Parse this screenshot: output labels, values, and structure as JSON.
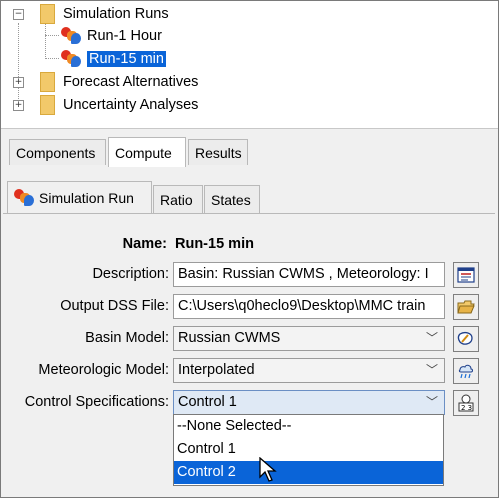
{
  "tree": {
    "items": [
      {
        "label": "Simulation Runs",
        "expander": "−"
      },
      {
        "label": "Run-1 Hour"
      },
      {
        "label": "Run-15 min",
        "selected": true
      },
      {
        "label": "Forecast Alternatives",
        "expander": "+"
      },
      {
        "label": "Uncertainty Analyses",
        "expander": "+"
      }
    ]
  },
  "outer_tabs": [
    {
      "label": "Components",
      "active": false
    },
    {
      "label": "Compute",
      "active": true
    },
    {
      "label": "Results",
      "active": false
    }
  ],
  "inner_tabs": [
    {
      "label": "Simulation Run",
      "active": true
    },
    {
      "label": "Ratio",
      "active": false
    },
    {
      "label": "States",
      "active": false
    }
  ],
  "form": {
    "name_label": "Name:",
    "name_value": "Run-15 min",
    "description_label": "Description:",
    "description_value": "Basin: Russian CWMS , Meteorology: I",
    "dss_label": "Output DSS File:",
    "dss_value": "C:\\Users\\q0heclo9\\Desktop\\MMC train",
    "basin_label": "Basin Model:",
    "basin_value": "Russian CWMS",
    "met_label": "Meteorologic Model:",
    "met_value": "Interpolated",
    "control_label": "Control Specifications:",
    "control_value": "Control 1"
  },
  "dropdown": {
    "options": [
      "--None Selected--",
      "Control 1",
      "Control 2"
    ],
    "highlighted": "Control 2"
  },
  "colors": {
    "selection": "#0a64d8",
    "panel": "#f0f0f0",
    "folder": "#f2c96a"
  },
  "icons": {
    "run": "simulation-run-icon",
    "folder": "folder-icon",
    "description_button": "edit-description-icon",
    "dss_button": "open-folder-icon",
    "basin_button": "basin-model-icon",
    "met_button": "meteorologic-model-icon",
    "control_button": "control-specs-icon"
  }
}
